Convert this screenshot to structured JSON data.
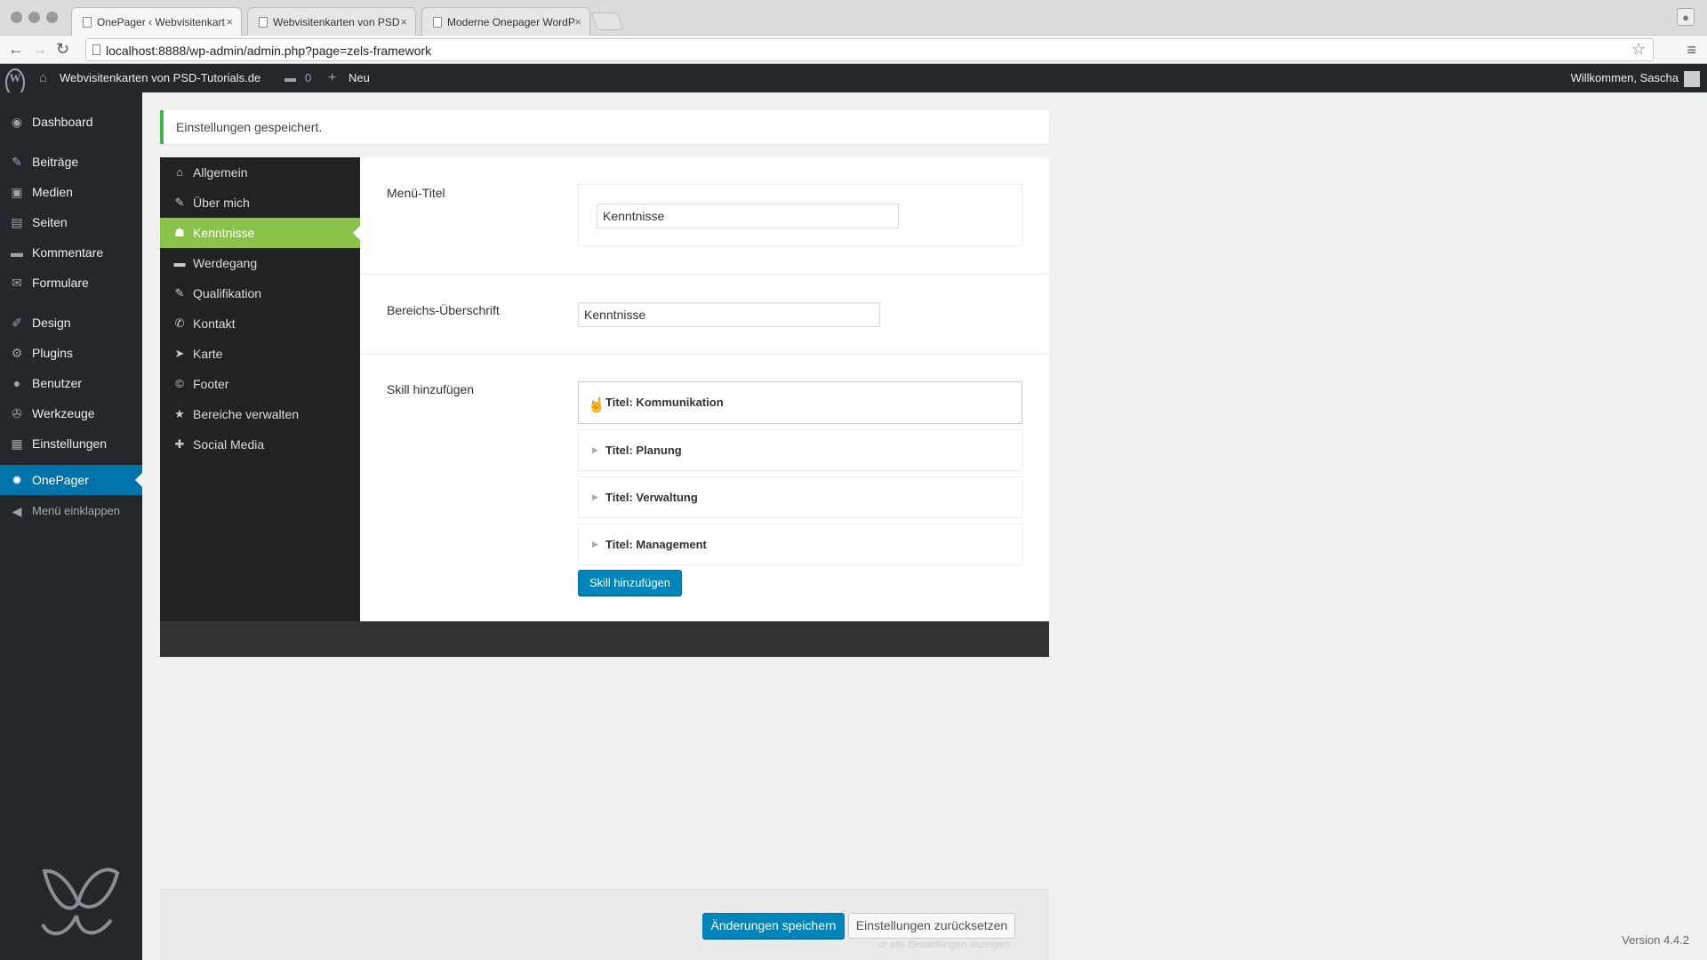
{
  "browser": {
    "tabs": [
      {
        "label": "OnePager ‹ Webvisitenkart",
        "active": true
      },
      {
        "label": "Webvisitenkarten von PSD",
        "active": false
      },
      {
        "label": "Moderne Onepager WordP",
        "active": false
      }
    ],
    "url": "localhost:8888/wp-admin/admin.php?page=zels-framework"
  },
  "adminbar": {
    "site_name": "Webvisitenkarten von PSD-Tutorials.de",
    "comments_count": "0",
    "new_label": "Neu",
    "greeting": "Willkommen, Sascha"
  },
  "sidebar": {
    "items": [
      {
        "label": "Dashboard",
        "icon": "dashboard-icon",
        "glyph": "◉"
      },
      {
        "label": "Beiträge",
        "icon": "pin-icon",
        "glyph": "✎"
      },
      {
        "label": "Medien",
        "icon": "media-icon",
        "glyph": "▣"
      },
      {
        "label": "Seiten",
        "icon": "pages-icon",
        "glyph": "▤"
      },
      {
        "label": "Kommentare",
        "icon": "comment-icon",
        "glyph": "▬"
      },
      {
        "label": "Formulare",
        "icon": "mail-icon",
        "glyph": "✉"
      },
      {
        "label": "Design",
        "icon": "brush-icon",
        "glyph": "✐"
      },
      {
        "label": "Plugins",
        "icon": "plugin-icon",
        "glyph": "⚙"
      },
      {
        "label": "Benutzer",
        "icon": "user-icon",
        "glyph": "●"
      },
      {
        "label": "Werkzeuge",
        "icon": "wrench-icon",
        "glyph": "✇"
      },
      {
        "label": "Einstellungen",
        "icon": "settings-icon",
        "glyph": "▦"
      },
      {
        "label": "OnePager",
        "icon": "gear-icon",
        "glyph": "✹"
      },
      {
        "label": "Menü einklappen",
        "icon": "collapse-icon",
        "glyph": "◀"
      }
    ]
  },
  "notice": {
    "text": "Einstellungen gespeichert."
  },
  "options_nav": {
    "items": [
      {
        "label": "Allgemein",
        "icon": "home-icon",
        "glyph": "⌂"
      },
      {
        "label": "Über mich",
        "icon": "pencil-icon",
        "glyph": "✎"
      },
      {
        "label": "Kenntnisse",
        "icon": "graduation-cap-icon",
        "glyph": "☗"
      },
      {
        "label": "Werdegang",
        "icon": "briefcase-icon",
        "glyph": "▬"
      },
      {
        "label": "Qualifikation",
        "icon": "pencil-icon",
        "glyph": "✎"
      },
      {
        "label": "Kontakt",
        "icon": "phone-icon",
        "glyph": "✆"
      },
      {
        "label": "Karte",
        "icon": "location-arrow-icon",
        "glyph": "➤"
      },
      {
        "label": "Footer",
        "icon": "copyright-icon",
        "glyph": "©"
      },
      {
        "label": "Bereiche verwalten",
        "icon": "star-icon",
        "glyph": "★"
      },
      {
        "label": "Social Media",
        "icon": "plus-icon",
        "glyph": "✚"
      }
    ]
  },
  "fields": {
    "menu_title_label": "Menü-Titel",
    "menu_title_value": "Kenntnisse",
    "section_heading_label": "Bereichs-Überschrift",
    "section_heading_value": "Kenntnisse",
    "add_skill_label": "Skill hinzufügen"
  },
  "skills": [
    {
      "title": "Titel: Kommunikation"
    },
    {
      "title": "Titel: Planung"
    },
    {
      "title": "Titel: Verwaltung"
    },
    {
      "title": "Titel: Management"
    }
  ],
  "buttons": {
    "add_skill": "Skill hinzufügen",
    "save": "Änderungen speichern",
    "reset": "Einstellungen zurücksetzen"
  },
  "footer": {
    "note": "or alle Einstellungen anzeigen",
    "version": "Version 4.4.2"
  },
  "colors": {
    "admin_bar": "#23282d",
    "accent_blue": "#0073aa",
    "accent_green": "#8bc34a",
    "notice_green": "#46b450"
  }
}
